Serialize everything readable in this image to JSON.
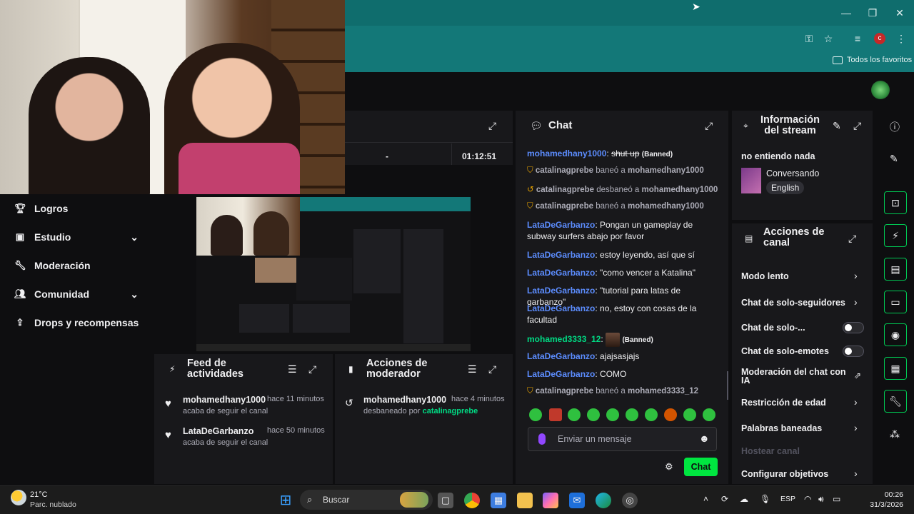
{
  "browser": {
    "bookmarks_label": "Todos los favoritos",
    "avatar_letter": "c",
    "accent": "#137878"
  },
  "sidebar": {
    "items": [
      {
        "label": "Logros",
        "icon": "trophy-icon"
      },
      {
        "label": "Estudio",
        "icon": "studio-icon"
      },
      {
        "label": "Moderación",
        "icon": "wrench-icon"
      },
      {
        "label": "Comunidad",
        "icon": "community-icon"
      },
      {
        "label": "Drops y recompensas",
        "icon": "drops-icon"
      }
    ]
  },
  "stats": {
    "dash": "-",
    "uptime": "01:12:51"
  },
  "activity_feed": {
    "title_line1": "Feed de",
    "title_line2": "actividades",
    "items": [
      {
        "user": "mohamedhany1000",
        "time": "hace 11 minutos",
        "text": "acaba de seguir el canal"
      },
      {
        "user": "LataDeGarbanzo",
        "time": "hace 50 minutos",
        "text": "acaba de seguir el canal"
      }
    ]
  },
  "mod_actions": {
    "title_line1": "Acciones de",
    "title_line2": "moderador",
    "items": [
      {
        "user": "mohamedhany1000",
        "time": "hace 4 minutos",
        "text_prefix": "desbaneado por",
        "actor": "catalinagprebe"
      }
    ]
  },
  "chat": {
    "title": "Chat",
    "messages": [
      {
        "user": "mohamedhany1000",
        "text": "shut up",
        "badge": "(Banned)"
      },
      {
        "system_user": "catalinagprebe",
        "action": "baneó a",
        "target": "mohamedhany1000"
      },
      {
        "system_user": "catalinagprebe",
        "action": "desbaneó a",
        "target": "mohamedhany1000"
      },
      {
        "system_user": "catalinagprebe",
        "action": "baneó a",
        "target": "mohamedhany1000"
      },
      {
        "user": "LataDeGarbanzo",
        "text": ": Pongan un gameplay de subway surfers abajo por favor"
      },
      {
        "user": "LataDeGarbanzo",
        "text": ": estoy leyendo, así que sí"
      },
      {
        "user": "LataDeGarbanzo",
        "text": ": \"como vencer a Katalina\""
      },
      {
        "user": "LataDeGarbanzo",
        "text": ": \"tutorial para latas de garbanzo\""
      },
      {
        "user": "LataDeGarbanzo",
        "text": ": no, estoy con cosas de la facultad"
      },
      {
        "user": "mohamed3333_12",
        "text": ":",
        "badge": "(Banned)"
      },
      {
        "user": "LataDeGarbanzo",
        "text": ": ajajsasjajs"
      },
      {
        "user": "LataDeGarbanzo",
        "text": ": COMO"
      },
      {
        "system_user": "catalinagprebe",
        "action": "baneó a",
        "target": "mohamed3333_12"
      }
    ],
    "input_placeholder": "Enviar un mensaje",
    "send_label": "Chat"
  },
  "stream_info": {
    "title_line1": "Información",
    "title_line2": "del stream",
    "stream_title": "no entiendo nada",
    "category": "Conversando",
    "language": "English"
  },
  "channel_actions": {
    "title_line1": "Acciones de",
    "title_line2": "canal",
    "items": [
      {
        "label": "Modo lento",
        "control": "arrow"
      },
      {
        "label": "Chat de solo-seguidores",
        "control": "arrow"
      },
      {
        "label": "Chat de solo-...",
        "control": "toggle",
        "on": false
      },
      {
        "label": "Chat de solo-emotes",
        "control": "toggle",
        "on": false
      },
      {
        "label_line1": "Moderación del chat con",
        "label_line2": "IA",
        "control": "external"
      },
      {
        "label": "Restricción de edad",
        "control": "arrow"
      },
      {
        "label": "Palabras baneadas",
        "control": "arrow"
      },
      {
        "label": "Hostear canal",
        "control": "none",
        "disabled": true
      },
      {
        "label": "Configurar objetivos",
        "control": "arrow"
      }
    ]
  },
  "taskbar": {
    "weather_temp": "21°C",
    "weather_desc": "Parc. nublado",
    "search_placeholder": "Buscar",
    "language": "ESP",
    "time": "00:26",
    "date": "31/3/2026"
  },
  "colors": {
    "twitch_green": "#00db84",
    "send_green": "#00e640",
    "username_blue": "#5c8dff",
    "panel_bg": "#18181b"
  }
}
